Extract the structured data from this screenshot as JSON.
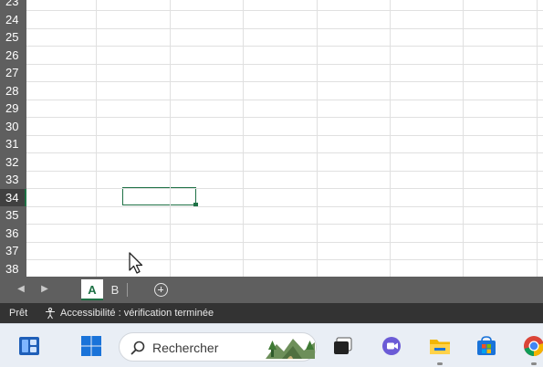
{
  "sheet": {
    "rows": [
      "23",
      "24",
      "25",
      "26",
      "27",
      "28",
      "29",
      "30",
      "31",
      "32",
      "33",
      "34",
      "35",
      "36",
      "37",
      "38"
    ],
    "active_row": "34"
  },
  "tabs": {
    "sheets": [
      "A",
      "B"
    ],
    "active": "A",
    "prev_icon": "chevron-left-icon",
    "next_icon": "chevron-right-icon",
    "add_icon": "plus-circle-icon"
  },
  "status": {
    "ready": "Prêt",
    "accessibility": "Accessibilité : vérification terminée"
  },
  "taskbar": {
    "search_placeholder": "Rechercher"
  },
  "colors": {
    "accent": "#1e7145",
    "header_bg": "#5f5f5f",
    "status_bg": "#333333",
    "taskbar_bg": "#e9eef5"
  }
}
